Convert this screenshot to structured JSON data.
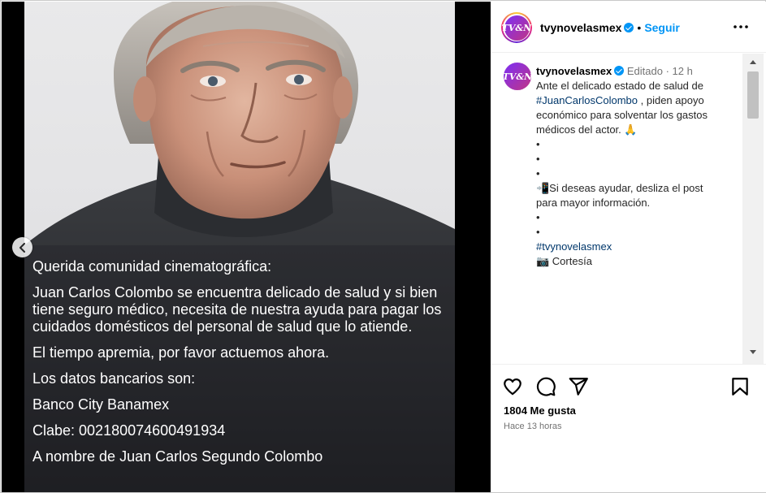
{
  "post": {
    "caption_lines": [
      "Querida comunidad cinematográfica:",
      "Juan Carlos Colombo se encuentra delicado de salud y si bien tiene seguro médico, necesita de nuestra ayuda para pagar los cuidados domésticos del personal de salud que lo atiende.",
      "El tiempo apremia, por favor actuemos ahora.",
      "Los datos bancarios son:",
      "Banco City Banamex",
      "Clabe: 002180074600491934",
      "A nombre de Juan Carlos Segundo Colombo"
    ]
  },
  "header": {
    "avatar_text": "TV&N",
    "username": "tvynovelasmex",
    "separator": "•",
    "follow_label": "Seguir"
  },
  "comment": {
    "username": "tvynovelasmex",
    "edited": "Editado",
    "sep": "·",
    "time": "12 h",
    "line1": "Ante el delicado estado de salud de",
    "hashtag_person": "#JuanCarlosColombo",
    "line2_rest": " , piden apoyo",
    "line3": "económico para solventar los gastos",
    "line4": "médicos del actor. 🙏",
    "bullet": "•",
    "help_line1": "📲Si deseas ayudar, desliza el post",
    "help_line2": "para mayor información.",
    "hashtag_page": "#tvynovelasmex",
    "credit": "📷 Cortesía"
  },
  "footer": {
    "likes": "1804 Me gusta",
    "ago": "Hace 13 horas"
  },
  "icons": {
    "prev": "chevron-left-icon",
    "more": "more-horizontal-icon",
    "like": "heart-icon",
    "comment": "comment-icon",
    "share": "share-icon",
    "save": "bookmark-icon",
    "verified": "verified-badge-icon"
  },
  "colors": {
    "accent": "#0095f6",
    "hashtag": "#00376b",
    "muted": "#737373",
    "sweater": "#2a2c30"
  }
}
